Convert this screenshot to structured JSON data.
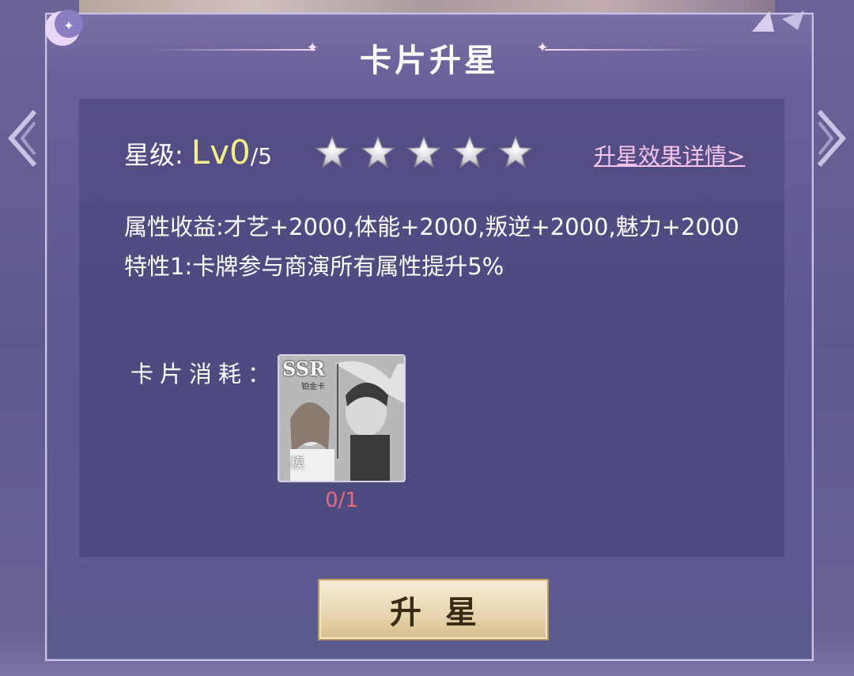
{
  "dialog": {
    "title": "卡片升星"
  },
  "star": {
    "label": "星级:",
    "level": "Lv0",
    "max": "/5",
    "stars_filled": 0,
    "stars_total": 5,
    "detail_link": "升星效果详情>"
  },
  "attributes": {
    "line1": "属性收益:才艺+2000,体能+2000,叛逆+2000,魅力+2000",
    "line2": "特性1:卡牌参与商演所有属性提升5%"
  },
  "consume": {
    "label": "卡片消耗：",
    "card_rarity": "SSR",
    "card_type": "铂金卡",
    "card_mark": "模",
    "count": "0/1"
  },
  "button": {
    "label": "升星"
  },
  "colors": {
    "level": "#f3f08c",
    "link": "#f7c6ef",
    "count": "#e56a7f",
    "button_text": "#3a2a14"
  }
}
